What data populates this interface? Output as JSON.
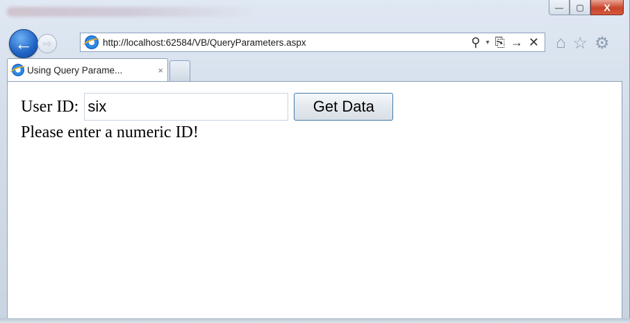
{
  "window": {
    "controls": {
      "minimize": "—",
      "maximize": "▢",
      "close": "X"
    }
  },
  "navigation": {
    "back_icon": "back-arrow-icon",
    "forward_icon": "forward-arrow-icon",
    "back_glyph": "←",
    "forward_glyph": "⇨"
  },
  "address_bar": {
    "url": "http://localhost:62584/VB/QueryParameters.aspx",
    "tools": {
      "search": "⚲",
      "dropdown": "▾",
      "compat": "⎘",
      "go": "→",
      "stop": "✕"
    }
  },
  "toolbar_icons": {
    "home": "⌂",
    "favorites": "☆",
    "settings": "⚙"
  },
  "tabs": [
    {
      "title": "Using Query Parame...",
      "close": "×"
    }
  ],
  "page": {
    "user_id_label": "User ID:",
    "user_id_value": "six",
    "get_data_button": "Get Data",
    "message": "Please enter a numeric ID!"
  },
  "colors": {
    "back_button": "#1e63c4",
    "close_button": "#c8442b",
    "button_border": "#3d7bad"
  }
}
